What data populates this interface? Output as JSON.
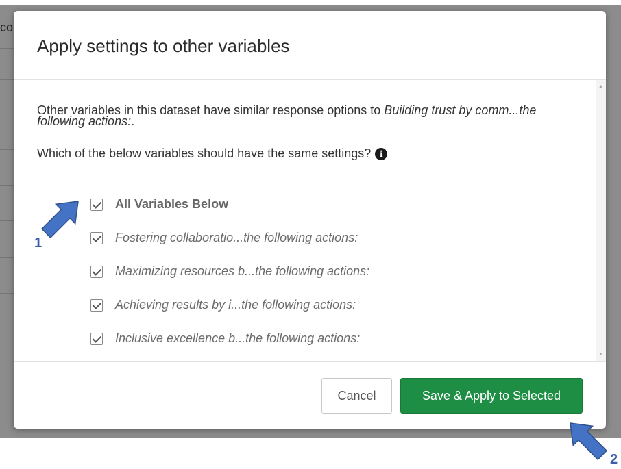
{
  "background": {
    "partial_text": "co"
  },
  "modal": {
    "title": "Apply settings to other variables",
    "intro_text": "Other variables in this dataset have similar response options to ",
    "intro_variable": "Building trust by comm...the following actions:",
    "intro_suffix": ".",
    "question": "Which of the below variables should have the same settings?",
    "options": [
      {
        "label": "All Variables Below",
        "checked": true
      },
      {
        "label": "Fostering collaboratio...the following actions:",
        "checked": true
      },
      {
        "label": "Maximizing resources b...the following actions:",
        "checked": true
      },
      {
        "label": "Achieving results by i...the following actions:",
        "checked": true
      },
      {
        "label": "Inclusive excellence b...the following actions:",
        "checked": true
      }
    ],
    "cancel_label": "Cancel",
    "save_label": "Save & Apply to Selected"
  },
  "annotations": {
    "label_1": "1",
    "label_2": "2"
  },
  "colors": {
    "primary_button": "#1e8e45",
    "annotation_arrow": "#4472c4"
  },
  "icons": {
    "info": "info-icon",
    "checkbox": "checkmark-icon"
  }
}
